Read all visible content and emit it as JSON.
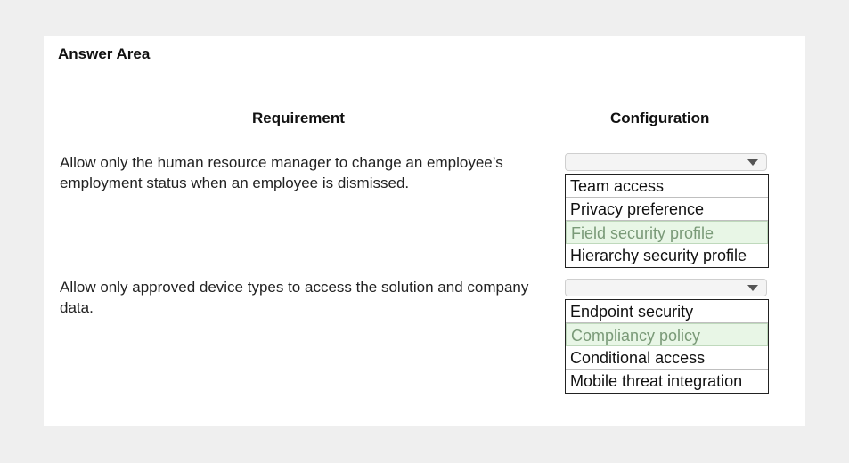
{
  "title": "Answer Area",
  "headers": {
    "requirement": "Requirement",
    "configuration": "Configuration"
  },
  "rows": [
    {
      "requirement": "Allow only the human resource manager to change an employee’s employment status when an employee is dismissed.",
      "selected_value": "",
      "options": [
        "Team access",
        "Privacy preference",
        "Field security profile",
        "Hierarchy security profile"
      ],
      "highlighted_option": "Field security profile"
    },
    {
      "requirement": "Allow only approved device types to access the solution and company data.",
      "selected_value": "",
      "options": [
        "Endpoint security",
        "Compliancy policy",
        "Conditional access",
        "Mobile threat integration"
      ],
      "highlighted_option": "Compliancy policy"
    }
  ],
  "colors": {
    "highlight_bg": "#e8f6e6",
    "highlight_text": "#7a9a78"
  }
}
